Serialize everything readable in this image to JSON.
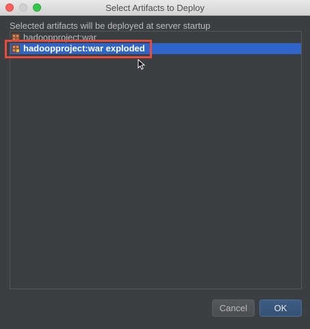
{
  "window": {
    "title": "Select Artifacts to Deploy"
  },
  "dialog": {
    "subtitle": "Selected artifacts will be deployed at server startup"
  },
  "artifacts": [
    {
      "label": "hadoopproject:war",
      "icon": "artifact-icon",
      "selected": false
    },
    {
      "label": "hadoopproject:war exploded",
      "icon": "artifact-exploded-icon",
      "selected": true
    }
  ],
  "buttons": {
    "cancel_label": "Cancel",
    "ok_label": "OK"
  },
  "colors": {
    "selection": "#2f65ca",
    "highlight_border": "#e84c3d",
    "background": "#3c3f41"
  }
}
